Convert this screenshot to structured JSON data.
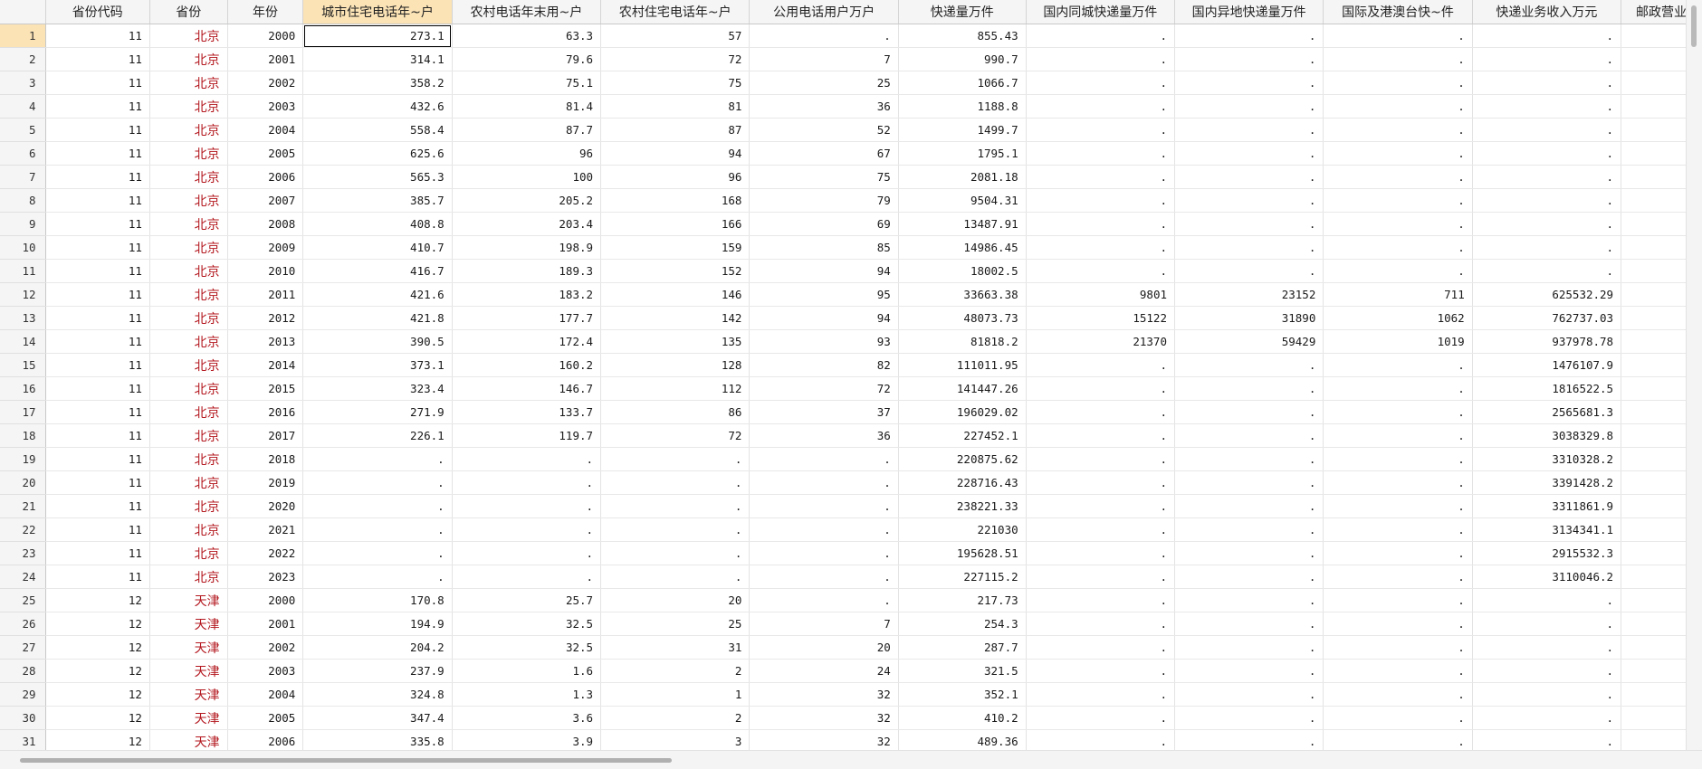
{
  "columns": [
    "省份代码",
    "省份",
    "年份",
    "城市住宅电话年~户",
    "农村电话年末用~户",
    "农村住宅电话年~户",
    "公用电话用户万户",
    "快递量万件",
    "国内同城快递量万件",
    "国内异地快递量万件",
    "国际及港澳台快~件",
    "快递业务收入万元",
    "邮政营业"
  ],
  "rows": [
    {
      "n": "1",
      "code": "11",
      "prov": "北京",
      "year": "2000",
      "v": [
        "273.1",
        "63.3",
        "57",
        ".",
        "855.43",
        ".",
        ".",
        ".",
        "."
      ]
    },
    {
      "n": "2",
      "code": "11",
      "prov": "北京",
      "year": "2001",
      "v": [
        "314.1",
        "79.6",
        "72",
        "7",
        "990.7",
        ".",
        ".",
        ".",
        "."
      ]
    },
    {
      "n": "3",
      "code": "11",
      "prov": "北京",
      "year": "2002",
      "v": [
        "358.2",
        "75.1",
        "75",
        "25",
        "1066.7",
        ".",
        ".",
        ".",
        "."
      ]
    },
    {
      "n": "4",
      "code": "11",
      "prov": "北京",
      "year": "2003",
      "v": [
        "432.6",
        "81.4",
        "81",
        "36",
        "1188.8",
        ".",
        ".",
        ".",
        "."
      ]
    },
    {
      "n": "5",
      "code": "11",
      "prov": "北京",
      "year": "2004",
      "v": [
        "558.4",
        "87.7",
        "87",
        "52",
        "1499.7",
        ".",
        ".",
        ".",
        "."
      ]
    },
    {
      "n": "6",
      "code": "11",
      "prov": "北京",
      "year": "2005",
      "v": [
        "625.6",
        "96",
        "94",
        "67",
        "1795.1",
        ".",
        ".",
        ".",
        "."
      ]
    },
    {
      "n": "7",
      "code": "11",
      "prov": "北京",
      "year": "2006",
      "v": [
        "565.3",
        "100",
        "96",
        "75",
        "2081.18",
        ".",
        ".",
        ".",
        "."
      ]
    },
    {
      "n": "8",
      "code": "11",
      "prov": "北京",
      "year": "2007",
      "v": [
        "385.7",
        "205.2",
        "168",
        "79",
        "9504.31",
        ".",
        ".",
        ".",
        "."
      ]
    },
    {
      "n": "9",
      "code": "11",
      "prov": "北京",
      "year": "2008",
      "v": [
        "408.8",
        "203.4",
        "166",
        "69",
        "13487.91",
        ".",
        ".",
        ".",
        "."
      ]
    },
    {
      "n": "10",
      "code": "11",
      "prov": "北京",
      "year": "2009",
      "v": [
        "410.7",
        "198.9",
        "159",
        "85",
        "14986.45",
        ".",
        ".",
        ".",
        "."
      ]
    },
    {
      "n": "11",
      "code": "11",
      "prov": "北京",
      "year": "2010",
      "v": [
        "416.7",
        "189.3",
        "152",
        "94",
        "18002.5",
        ".",
        ".",
        ".",
        "."
      ]
    },
    {
      "n": "12",
      "code": "11",
      "prov": "北京",
      "year": "2011",
      "v": [
        "421.6",
        "183.2",
        "146",
        "95",
        "33663.38",
        "9801",
        "23152",
        "711",
        "625532.29"
      ]
    },
    {
      "n": "13",
      "code": "11",
      "prov": "北京",
      "year": "2012",
      "v": [
        "421.8",
        "177.7",
        "142",
        "94",
        "48073.73",
        "15122",
        "31890",
        "1062",
        "762737.03"
      ]
    },
    {
      "n": "14",
      "code": "11",
      "prov": "北京",
      "year": "2013",
      "v": [
        "390.5",
        "172.4",
        "135",
        "93",
        "81818.2",
        "21370",
        "59429",
        "1019",
        "937978.78"
      ]
    },
    {
      "n": "15",
      "code": "11",
      "prov": "北京",
      "year": "2014",
      "v": [
        "373.1",
        "160.2",
        "128",
        "82",
        "111011.95",
        ".",
        ".",
        ".",
        "1476107.9"
      ]
    },
    {
      "n": "16",
      "code": "11",
      "prov": "北京",
      "year": "2015",
      "v": [
        "323.4",
        "146.7",
        "112",
        "72",
        "141447.26",
        ".",
        ".",
        ".",
        "1816522.5"
      ]
    },
    {
      "n": "17",
      "code": "11",
      "prov": "北京",
      "year": "2016",
      "v": [
        "271.9",
        "133.7",
        "86",
        "37",
        "196029.02",
        ".",
        ".",
        ".",
        "2565681.3"
      ]
    },
    {
      "n": "18",
      "code": "11",
      "prov": "北京",
      "year": "2017",
      "v": [
        "226.1",
        "119.7",
        "72",
        "36",
        "227452.1",
        ".",
        ".",
        ".",
        "3038329.8"
      ]
    },
    {
      "n": "19",
      "code": "11",
      "prov": "北京",
      "year": "2018",
      "v": [
        ".",
        ".",
        ".",
        ".",
        "220875.62",
        ".",
        ".",
        ".",
        "3310328.2"
      ]
    },
    {
      "n": "20",
      "code": "11",
      "prov": "北京",
      "year": "2019",
      "v": [
        ".",
        ".",
        ".",
        ".",
        "228716.43",
        ".",
        ".",
        ".",
        "3391428.2"
      ]
    },
    {
      "n": "21",
      "code": "11",
      "prov": "北京",
      "year": "2020",
      "v": [
        ".",
        ".",
        ".",
        ".",
        "238221.33",
        ".",
        ".",
        ".",
        "3311861.9"
      ]
    },
    {
      "n": "22",
      "code": "11",
      "prov": "北京",
      "year": "2021",
      "v": [
        ".",
        ".",
        ".",
        ".",
        "221030",
        ".",
        ".",
        ".",
        "3134341.1"
      ]
    },
    {
      "n": "23",
      "code": "11",
      "prov": "北京",
      "year": "2022",
      "v": [
        ".",
        ".",
        ".",
        ".",
        "195628.51",
        ".",
        ".",
        ".",
        "2915532.3"
      ]
    },
    {
      "n": "24",
      "code": "11",
      "prov": "北京",
      "year": "2023",
      "v": [
        ".",
        ".",
        ".",
        ".",
        "227115.2",
        ".",
        ".",
        ".",
        "3110046.2"
      ]
    },
    {
      "n": "25",
      "code": "12",
      "prov": "天津",
      "year": "2000",
      "v": [
        "170.8",
        "25.7",
        "20",
        ".",
        "217.73",
        ".",
        ".",
        ".",
        "."
      ]
    },
    {
      "n": "26",
      "code": "12",
      "prov": "天津",
      "year": "2001",
      "v": [
        "194.9",
        "32.5",
        "25",
        "7",
        "254.3",
        ".",
        ".",
        ".",
        "."
      ]
    },
    {
      "n": "27",
      "code": "12",
      "prov": "天津",
      "year": "2002",
      "v": [
        "204.2",
        "32.5",
        "31",
        "20",
        "287.7",
        ".",
        ".",
        ".",
        "."
      ]
    },
    {
      "n": "28",
      "code": "12",
      "prov": "天津",
      "year": "2003",
      "v": [
        "237.9",
        "1.6",
        "2",
        "24",
        "321.5",
        ".",
        ".",
        ".",
        "."
      ]
    },
    {
      "n": "29",
      "code": "12",
      "prov": "天津",
      "year": "2004",
      "v": [
        "324.8",
        "1.3",
        "1",
        "32",
        "352.1",
        ".",
        ".",
        ".",
        "."
      ]
    },
    {
      "n": "30",
      "code": "12",
      "prov": "天津",
      "year": "2005",
      "v": [
        "347.4",
        "3.6",
        "2",
        "32",
        "410.2",
        ".",
        ".",
        ".",
        "."
      ]
    },
    {
      "n": "31",
      "code": "12",
      "prov": "天津",
      "year": "2006",
      "v": [
        "335.8",
        "3.9",
        "3",
        "32",
        "489.36",
        ".",
        ".",
        ".",
        "."
      ]
    }
  ]
}
